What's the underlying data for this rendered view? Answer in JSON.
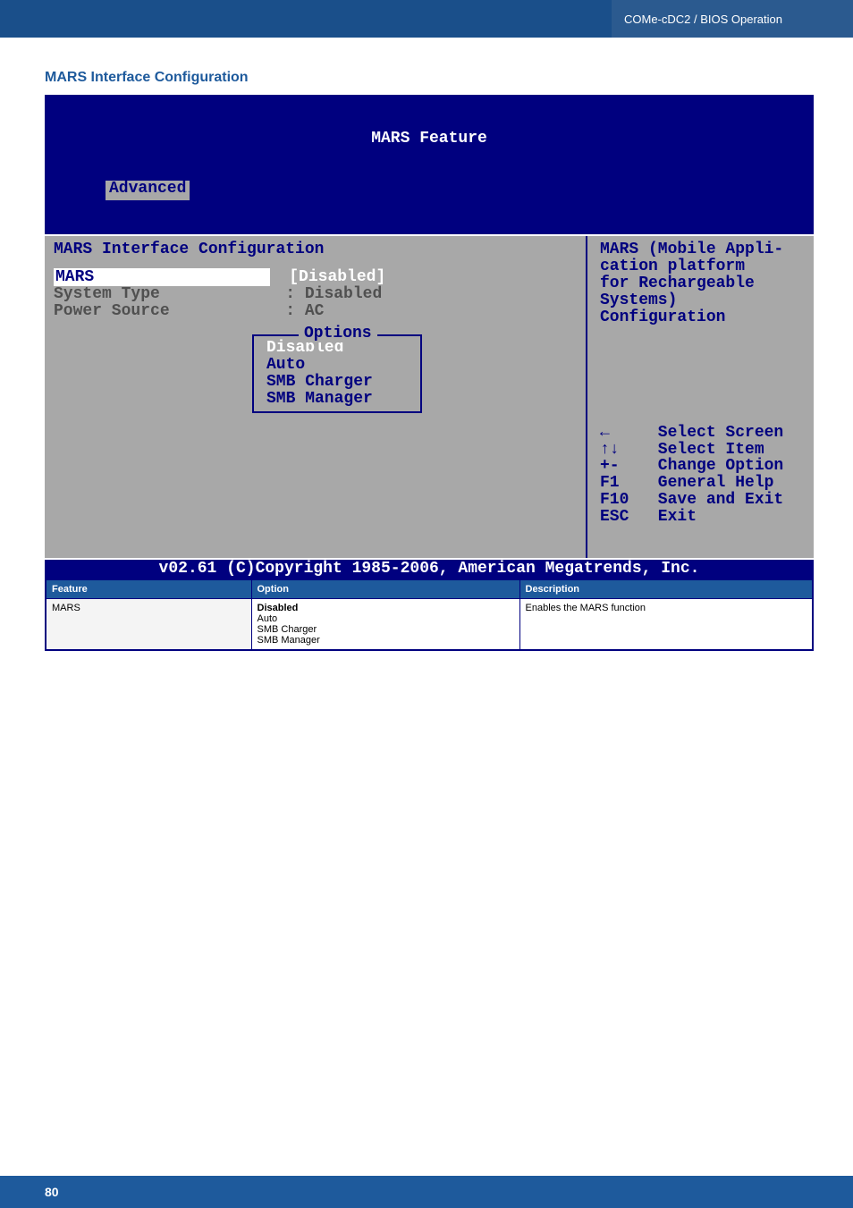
{
  "header": {
    "breadcrumb": "COMe-cDC2 / BIOS Operation"
  },
  "section_title": "MARS Interface Configuration",
  "bios": {
    "title": "MARS Feature",
    "tab_active": "Advanced",
    "left": {
      "heading": "MARS Interface Configuration",
      "rows": [
        {
          "label": "MARS",
          "value": "[Disabled]",
          "selected": true
        },
        {
          "label": "System Type",
          "value": ": Disabled",
          "selected": false
        },
        {
          "label": "Power Source",
          "value": ": AC",
          "selected": false
        }
      ],
      "options_title": "Options",
      "options": [
        "Disabled",
        "Auto",
        "SMB Charger",
        "SMB Manager"
      ],
      "options_selected_index": 0
    },
    "right": {
      "desc": "MARS (Mobile Appli-\ncation platform\nfor Rechargeable\nSystems)\nConfiguration",
      "help": [
        {
          "key": "←",
          "text": "Select Screen"
        },
        {
          "key": "↑↓",
          "text": "Select Item"
        },
        {
          "key": "+-",
          "text": "Change Option"
        },
        {
          "key": "F1",
          "text": "General Help"
        },
        {
          "key": "F10",
          "text": "Save and Exit"
        },
        {
          "key": "ESC",
          "text": "Exit"
        }
      ]
    },
    "footer": "v02.61 (C)Copyright 1985-2006, American Megatrends, Inc."
  },
  "feature_table": {
    "headers": [
      "Feature",
      "Option",
      "Description"
    ],
    "rows": [
      {
        "feature": "MARS",
        "options": [
          "Disabled",
          "Auto",
          "SMB Charger",
          "SMB Manager"
        ],
        "bold_option_index": 0,
        "description": "Enables the MARS function"
      }
    ]
  },
  "page_number": "80"
}
